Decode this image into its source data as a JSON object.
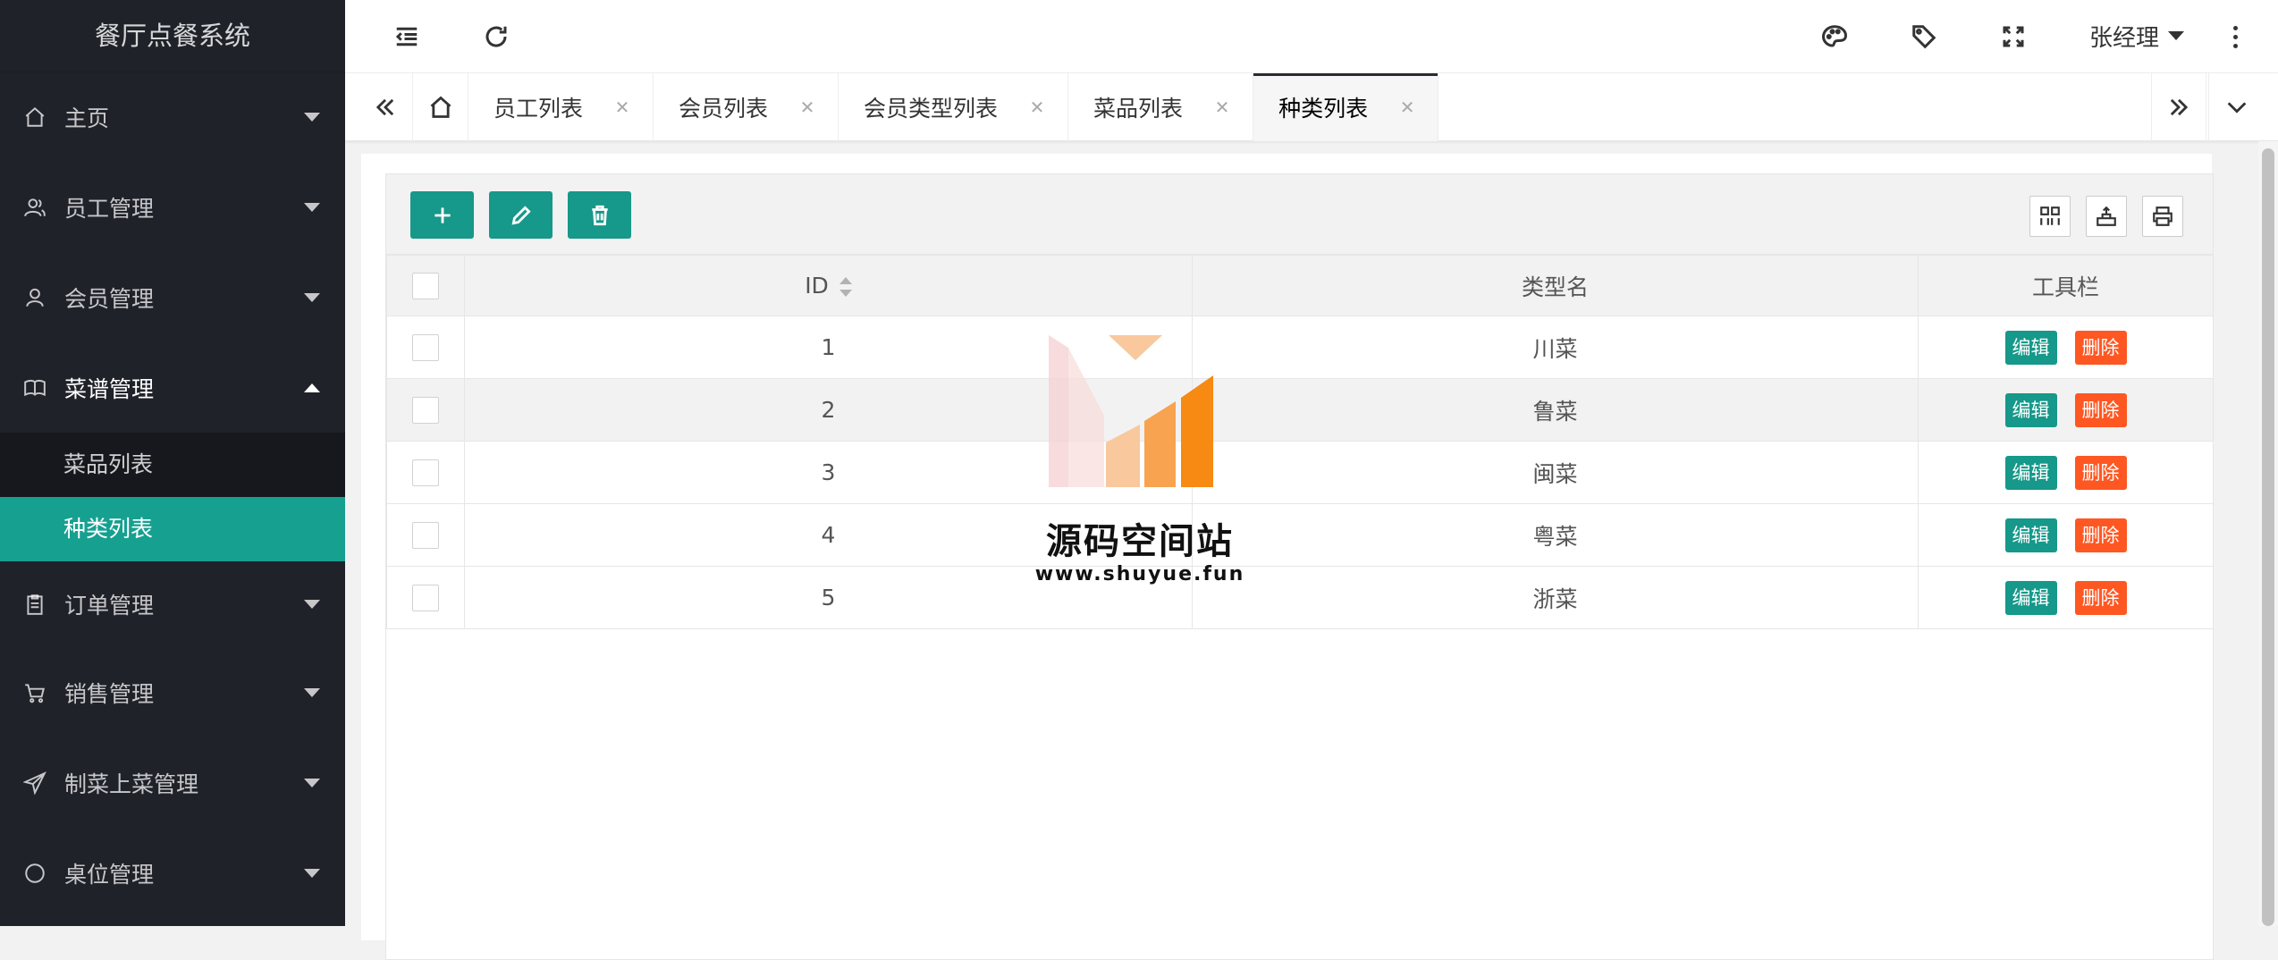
{
  "app": {
    "title": "餐厅点餐系统"
  },
  "sidebar": {
    "items": [
      {
        "label": "主页",
        "icon": "home-icon"
      },
      {
        "label": "员工管理",
        "icon": "users-icon"
      },
      {
        "label": "会员管理",
        "icon": "user-icon"
      },
      {
        "label": "菜谱管理",
        "icon": "book-icon",
        "open": true,
        "children": [
          {
            "label": "菜品列表"
          },
          {
            "label": "种类列表",
            "active": true
          }
        ]
      },
      {
        "label": "订单管理",
        "icon": "clipboard-icon"
      },
      {
        "label": "销售管理",
        "icon": "cart-icon"
      },
      {
        "label": "制菜上菜管理",
        "icon": "send-icon"
      },
      {
        "label": "桌位管理",
        "icon": "circle-icon"
      }
    ]
  },
  "header": {
    "username": "张经理"
  },
  "tabs": [
    {
      "label": "员工列表"
    },
    {
      "label": "会员列表"
    },
    {
      "label": "会员类型列表"
    },
    {
      "label": "菜品列表"
    },
    {
      "label": "种类列表",
      "active": true
    }
  ],
  "table": {
    "columns": {
      "id": "ID",
      "name": "类型名",
      "tools": "工具栏"
    },
    "rows": [
      {
        "id": "1",
        "name": "川菜"
      },
      {
        "id": "2",
        "name": "鲁菜"
      },
      {
        "id": "3",
        "name": "闽菜"
      },
      {
        "id": "4",
        "name": "粤菜"
      },
      {
        "id": "5",
        "name": "浙菜"
      }
    ],
    "edit_label": "编辑",
    "delete_label": "删除"
  },
  "watermark": {
    "title": "源码空间站",
    "url": "www.shuyue.fun"
  },
  "colors": {
    "sidebar_bg": "#20222a",
    "accent": "#16988a",
    "danger": "#ff5722"
  }
}
